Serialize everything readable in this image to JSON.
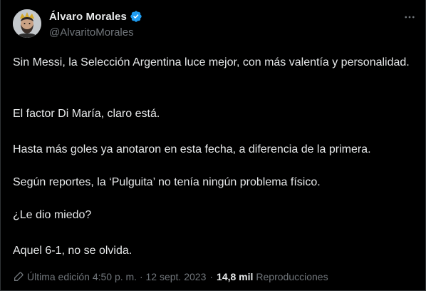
{
  "author": {
    "name": "Álvaro Morales",
    "handle": "@AlvaritoMorales",
    "verified_icon": "verified-badge-icon",
    "avatar_icon": "avatar"
  },
  "menu": {
    "more_icon": "more-horizontal-icon"
  },
  "tweet": {
    "paragraphs": [
      "Sin Messi, la Selección Argentina luce mejor, con más valentía y personalidad.",
      "El factor Di María, claro está.",
      "Hasta más goles ya anotaron en esta fecha, a diferencia de la primera.",
      "Según reportes, la ‘Pulguita’ no tenía ningún problema físico.",
      "¿Le dio miedo?",
      "Aquel 6-1, no se olvida."
    ]
  },
  "meta": {
    "edit_icon": "pencil-icon",
    "last_edit_label": "Última edición 4:50 p. m. · 12 sept. 2023",
    "separator": "·",
    "views_count": "14,8 mil",
    "views_label": "Reproducciones"
  },
  "colors": {
    "background": "#000000",
    "text": "#e7e9ea",
    "secondary": "#71767b",
    "verified": "#1d9bf0",
    "border": "#2f3336"
  }
}
